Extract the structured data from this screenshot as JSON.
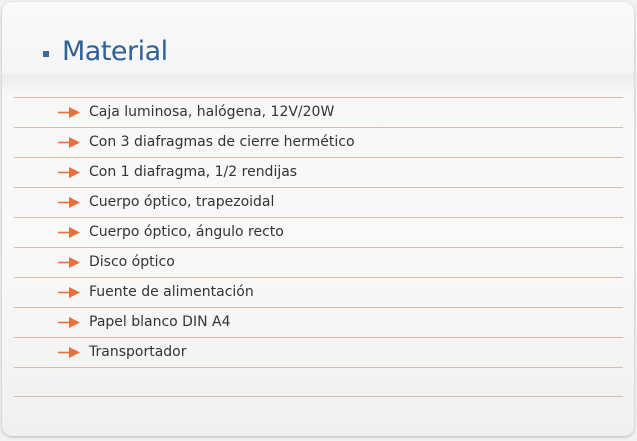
{
  "header": {
    "title": "Material"
  },
  "colors": {
    "title": "#2e5f95",
    "bullet": "#3d6a9c",
    "arrow": "#e8703a",
    "divider": "#e0b9a3",
    "text": "#333333"
  },
  "items": [
    {
      "label": "Caja luminosa, halógena, 12V/20W",
      "icon": "arrow-right-icon"
    },
    {
      "label": "Con 3 diafragmas de cierre hermético",
      "icon": "arrow-right-icon"
    },
    {
      "label": "Con 1 diafragma, 1/2 rendijas",
      "icon": "arrow-right-icon"
    },
    {
      "label": "Cuerpo óptico, trapezoidal",
      "icon": "arrow-right-icon"
    },
    {
      "label": "Cuerpo óptico, ángulo recto",
      "icon": "arrow-right-icon"
    },
    {
      "label": "Disco óptico",
      "icon": "arrow-right-icon"
    },
    {
      "label": "Fuente de alimentación",
      "icon": "arrow-right-icon"
    },
    {
      "label": "Papel blanco DIN A4",
      "icon": "arrow-right-icon"
    },
    {
      "label": "Transportador",
      "icon": "arrow-right-icon"
    }
  ]
}
